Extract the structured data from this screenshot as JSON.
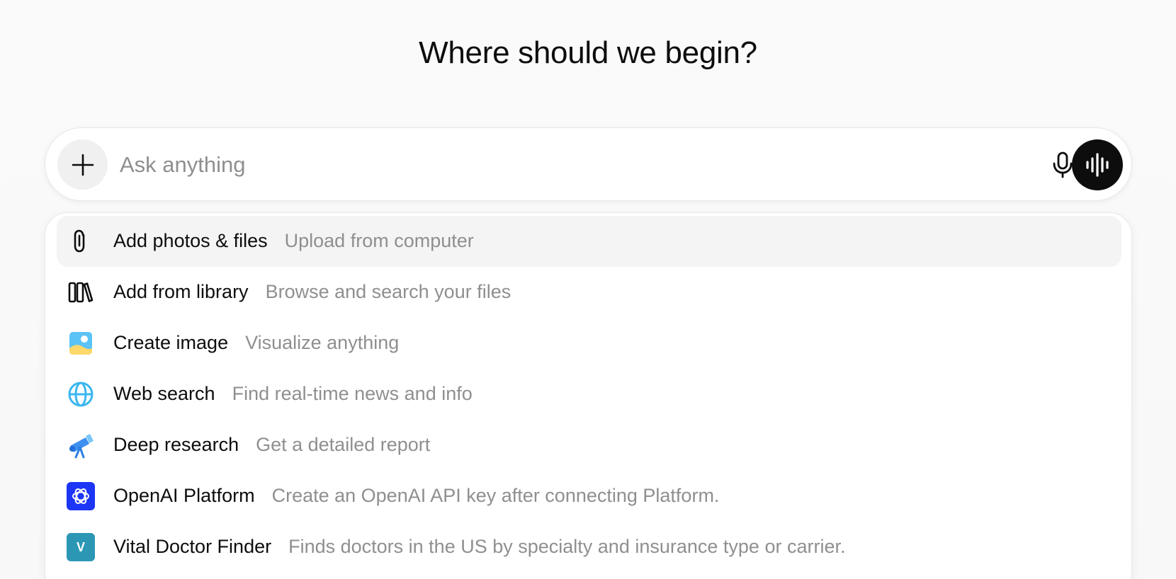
{
  "heading": "Where should we begin?",
  "composer": {
    "placeholder": "Ask anything",
    "value": ""
  },
  "menu": {
    "items": [
      {
        "label": "Add photos & files",
        "description": "Upload from computer",
        "icon": "paperclip-icon"
      },
      {
        "label": "Add from library",
        "description": "Browse and search your files",
        "icon": "library-icon"
      },
      {
        "label": "Create image",
        "description": "Visualize anything",
        "icon": "image-icon"
      },
      {
        "label": "Web search",
        "description": "Find real-time news and info",
        "icon": "globe-icon"
      },
      {
        "label": "Deep research",
        "description": "Get a detailed report",
        "icon": "telescope-icon"
      },
      {
        "label": "OpenAI Platform",
        "description": "Create an OpenAI API key after connecting Platform.",
        "icon": "openai-logo-icon"
      },
      {
        "label": "Vital Doctor Finder",
        "description": "Finds doctors in the US by specialty and insurance type or carrier.",
        "icon": "vital-app-icon",
        "badge": "V"
      }
    ]
  },
  "colors": {
    "accent_dark": "#0d0d0d",
    "muted_text": "#8f8f8f",
    "openai_badge": "#1d35f5",
    "vital_badge": "#2b97b5",
    "globe": "#3bb6f0"
  }
}
